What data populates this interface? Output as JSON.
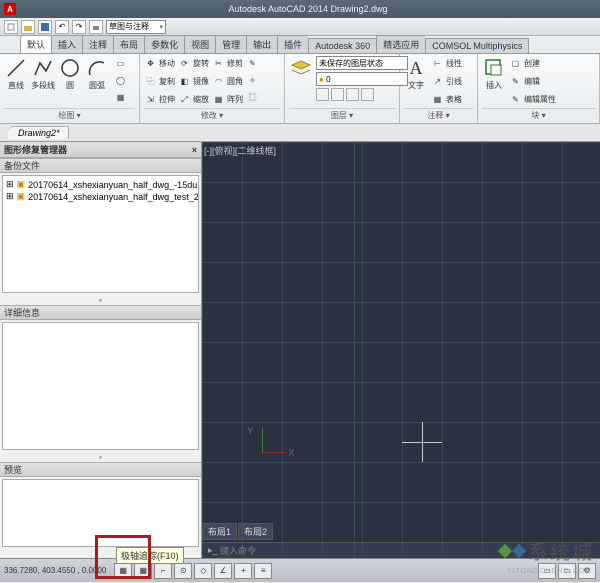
{
  "app": {
    "logo_letter": "A",
    "title_center": "Autodesk AutoCAD 2014    Drawing2.dwg"
  },
  "qat": {
    "combo": "草图与注释",
    "arrow": "▾"
  },
  "tabs": [
    "默认",
    "插入",
    "注释",
    "布局",
    "参数化",
    "视图",
    "管理",
    "输出",
    "插件",
    "Autodesk 360",
    "精选应用",
    "COMSOL Multiphysics"
  ],
  "ribbon": {
    "draw": {
      "title": "绘图 ▾",
      "line": "直线",
      "polyline": "多段线",
      "circle": "圆",
      "arc": "圆弧"
    },
    "modify": {
      "title": "修改 ▾",
      "move": "移动",
      "rotate": "旋转",
      "trim": "修剪",
      "copy": "复制",
      "mirror": "镜像",
      "fillet": "圆角",
      "stretch": "拉伸",
      "scale": "缩放",
      "array": "阵列"
    },
    "layers": {
      "title": "图层 ▾",
      "unsaved": "未保存的图层状态",
      "current": "0"
    },
    "annot": {
      "title": "注释 ▾",
      "text": "文字",
      "linear": "线性",
      "leader": "引线",
      "table": "表格"
    },
    "block": {
      "title": "块 ▾",
      "insert": "插入",
      "create": "创建",
      "edit": "编辑",
      "editattr": "编辑属性"
    }
  },
  "doctab": "Drawing2*",
  "sidebar": {
    "title": "图形修复管理器",
    "close": "×",
    "backup_title": "备份文件",
    "files": [
      "20170614_xshexianyuan_half_dwg_-15du",
      "20170614_xshexianyuan_half_dwg_test_2"
    ],
    "details_title": "详细信息",
    "preview_title": "预览"
  },
  "viewport": {
    "label": "[-][俯视][二维线框]",
    "y": "Y",
    "x": "X"
  },
  "layouts": {
    "l1": "布局1",
    "l2": "布局2"
  },
  "cmdline": {
    "placeholder": "键入命令"
  },
  "status": {
    "coords": "336.7280, 403.4550 , 0.0000",
    "tooltip": "极轴追踪(F10)"
  },
  "watermark": {
    "text": "系统城",
    "url": "YITONGCHENG.COM"
  }
}
